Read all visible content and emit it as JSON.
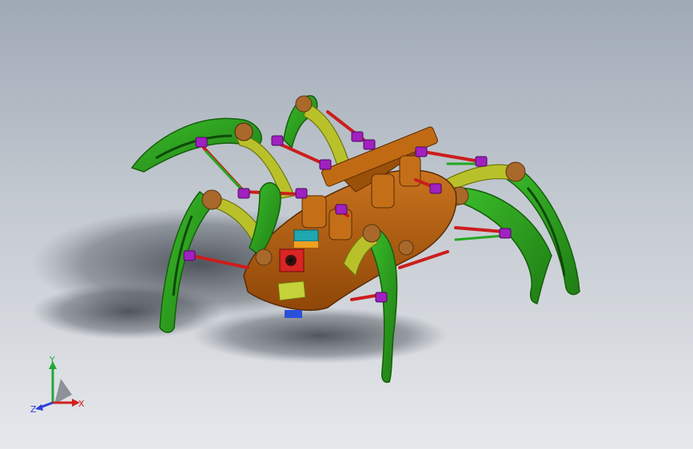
{
  "viewport": {
    "background_top": "#9fa9b6",
    "background_bottom": "#e6e8ec"
  },
  "model": {
    "colors": {
      "leg_outer": "#2ea31f",
      "leg_inner": "#b9c12a",
      "joint": "#a8692a",
      "body": "#b75f0c",
      "servo_bracket": "#a020c0",
      "rod": "#cc1d1d",
      "link_rod": "#23a81f",
      "camera": "#d92424",
      "sensor_block": "#1fa8b0"
    }
  },
  "triad": {
    "x_label": "X",
    "y_label": "Y",
    "z_label": "Z",
    "x_color": "#d42020",
    "y_color": "#21a83a",
    "z_color": "#2b3fd8"
  }
}
